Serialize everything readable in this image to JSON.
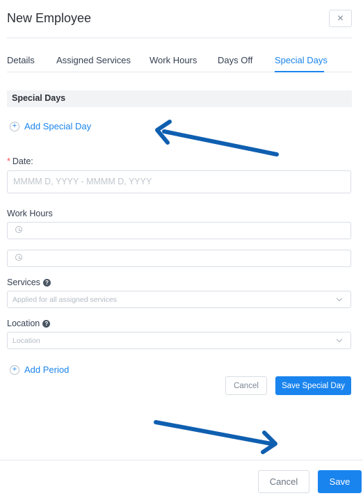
{
  "dialog": {
    "title": "New Employee",
    "close_label": "×"
  },
  "tabs": [
    {
      "label": "Details"
    },
    {
      "label": "Assigned Services"
    },
    {
      "label": "Work Hours"
    },
    {
      "label": "Days Off"
    },
    {
      "label": "Special Days"
    }
  ],
  "section": {
    "title": "Special Days"
  },
  "add_special_day": {
    "plus": "+",
    "label": "Add Special Day"
  },
  "date": {
    "required_mark": "*",
    "label": "Date:",
    "placeholder": "MMMM D, YYYY - MMMM D, YYYY"
  },
  "work_hours": {
    "label": "Work Hours"
  },
  "services": {
    "label": "Services",
    "help": "?",
    "placeholder": "Applied for all assigned services"
  },
  "location": {
    "label": "Location",
    "help": "?",
    "placeholder": "Location"
  },
  "add_period": {
    "plus": "+",
    "label": "Add Period"
  },
  "form_actions": {
    "cancel_label": "Cancel",
    "save_label": "Save Special Day"
  },
  "footer": {
    "cancel_label": "Cancel",
    "save_label": "Save"
  },
  "colors": {
    "accent": "#1a84ee",
    "arrow": "#0f5fb0",
    "required": "#ff4d4f"
  }
}
